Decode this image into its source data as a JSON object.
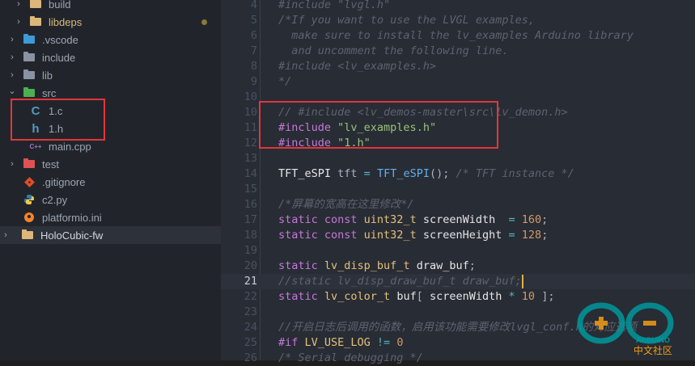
{
  "explorer": {
    "items": [
      {
        "label": "build",
        "chevron": "›",
        "icon": "folder-icon",
        "color": "#dcb67a",
        "text_color": "#9da5b4"
      },
      {
        "label": "libdeps",
        "chevron": "›",
        "icon": "folder-icon",
        "color": "#dcb67a",
        "text_color": "#d7ba7d",
        "modified_dot": "#8a7a3a"
      },
      {
        "label": ".vscode",
        "chevron": "›",
        "icon": "vscode-folder-icon",
        "color": "#3c9bd8",
        "text_color": "#9da5b4"
      },
      {
        "label": "include",
        "chevron": "›",
        "icon": "include-folder-icon",
        "color": "#8a93a3",
        "text_color": "#9da5b4"
      },
      {
        "label": "lib",
        "chevron": "›",
        "icon": "lib-folder-icon",
        "color": "#8a93a3",
        "text_color": "#9da5b4"
      },
      {
        "label": "src",
        "chevron": "⌄",
        "icon": "src-folder-icon",
        "color": "#4caf50",
        "text_color": "#9da5b4"
      },
      {
        "label": "1.c",
        "chevron": "",
        "icon": "c-file-icon",
        "icon_text": "C",
        "color": "#519aba",
        "text_color": "#9da5b4"
      },
      {
        "label": "1.h",
        "chevron": "",
        "icon": "h-file-icon",
        "icon_text": "h",
        "color": "#519aba",
        "text_color": "#9da5b4"
      },
      {
        "label": "main.cpp",
        "chevron": "",
        "icon": "cpp-file-icon",
        "icon_text": "C++",
        "color": "#a074c4",
        "text_color": "#9da5b4"
      },
      {
        "label": "test",
        "chevron": "›",
        "icon": "test-folder-icon",
        "color": "#e05252",
        "text_color": "#9da5b4"
      },
      {
        "label": ".gitignore",
        "chevron": "",
        "icon": "git-icon",
        "color": "#e44d26",
        "text_color": "#9da5b4"
      },
      {
        "label": "c2.py",
        "chevron": "",
        "icon": "python-icon",
        "color": "#3c78aa",
        "text_color": "#9da5b4"
      },
      {
        "label": "platformio.ini",
        "chevron": "",
        "icon": "platformio-icon",
        "color": "#f5822a",
        "text_color": "#9da5b4"
      },
      {
        "label": "HoloCubic-fw",
        "chevron": "›",
        "icon": "folder-icon",
        "color": "#dcb67a",
        "text_color": "#d4d7dd",
        "selected": true
      }
    ]
  },
  "editor": {
    "current_line": "21",
    "lines": [
      {
        "n": "4",
        "tokens": [
          [
            "cm",
            "#include \"lvgl.h\""
          ]
        ]
      },
      {
        "n": "5",
        "tokens": [
          [
            "cm",
            "/*If you want to use the LVGL examples,"
          ]
        ]
      },
      {
        "n": "6",
        "tokens": [
          [
            "cm",
            "  make sure to install the lv_examples Arduino library"
          ]
        ]
      },
      {
        "n": "7",
        "tokens": [
          [
            "cm",
            "  and uncomment the following line."
          ]
        ]
      },
      {
        "n": "8",
        "tokens": [
          [
            "cm",
            "#include <lv_examples.h>"
          ]
        ]
      },
      {
        "n": "9",
        "tokens": [
          [
            "cm",
            "*/"
          ]
        ]
      },
      {
        "n": "10",
        "tokens": []
      },
      {
        "n": "10",
        "tokens": [
          [
            "cm",
            "// #include <lv_demos-master\\src\\lv_demon.h>"
          ]
        ]
      },
      {
        "n": "11",
        "tokens": [
          [
            "kw",
            "#include "
          ],
          [
            "str",
            "\"lv_examples.h\""
          ]
        ]
      },
      {
        "n": "12",
        "tokens": [
          [
            "kw",
            "#include "
          ],
          [
            "str",
            "\"1.h\""
          ]
        ]
      },
      {
        "n": "13",
        "tokens": []
      },
      {
        "n": "14",
        "tokens": [
          [
            "var",
            "TFT_eSPI"
          ],
          [
            "pl",
            " tft "
          ],
          [
            "op",
            "="
          ],
          [
            "pl",
            " "
          ],
          [
            "fn",
            "TFT_eSPI"
          ],
          [
            "pl",
            "(); "
          ],
          [
            "cm",
            "/* TFT instance */"
          ]
        ]
      },
      {
        "n": "15",
        "tokens": []
      },
      {
        "n": "16",
        "tokens": [
          [
            "cm",
            "/*屏幕的宽高在这里修改*/"
          ]
        ]
      },
      {
        "n": "17",
        "tokens": [
          [
            "kw",
            "static const "
          ],
          [
            "ty",
            "uint32_t "
          ],
          [
            "var",
            "screenWidth"
          ],
          [
            "pl",
            "  "
          ],
          [
            "op",
            "="
          ],
          [
            "pl",
            " "
          ],
          [
            "num",
            "160"
          ],
          [
            "pl",
            ";"
          ]
        ]
      },
      {
        "n": "18",
        "tokens": [
          [
            "kw",
            "static const "
          ],
          [
            "ty",
            "uint32_t "
          ],
          [
            "var",
            "screenHeight"
          ],
          [
            "pl",
            " "
          ],
          [
            "op",
            "="
          ],
          [
            "pl",
            " "
          ],
          [
            "num",
            "128"
          ],
          [
            "pl",
            ";"
          ]
        ]
      },
      {
        "n": "19",
        "tokens": []
      },
      {
        "n": "20",
        "tokens": [
          [
            "kw",
            "static "
          ],
          [
            "ty",
            "lv_disp_buf_t "
          ],
          [
            "var",
            "draw_buf"
          ],
          [
            "pl",
            ";"
          ]
        ]
      },
      {
        "n": "21",
        "tokens": [
          [
            "cm",
            "//static lv_disp_draw_buf_t draw_buf;"
          ]
        ]
      },
      {
        "n": "22",
        "tokens": [
          [
            "kw",
            "static "
          ],
          [
            "ty",
            "lv_color_t "
          ],
          [
            "var",
            "buf"
          ],
          [
            "pl",
            "[ "
          ],
          [
            "var",
            "screenWidth"
          ],
          [
            "pl",
            " "
          ],
          [
            "op",
            "*"
          ],
          [
            "pl",
            " "
          ],
          [
            "num",
            "10"
          ],
          [
            "pl",
            " ];"
          ]
        ]
      },
      {
        "n": "23",
        "tokens": []
      },
      {
        "n": "24",
        "tokens": [
          [
            "cm",
            "//开启日志后调用的函数，启用该功能需要修改lvgl_conf.h的对应选项"
          ]
        ]
      },
      {
        "n": "25",
        "tokens": [
          [
            "kw",
            "#if "
          ],
          [
            "ty",
            "LV_USE_LOG "
          ],
          [
            "op",
            "!="
          ],
          [
            "pl",
            " "
          ],
          [
            "num",
            "0"
          ]
        ]
      },
      {
        "n": "26",
        "tokens": [
          [
            "cm",
            "/* Serial debugging */"
          ]
        ]
      }
    ]
  },
  "watermark": {
    "brand": "ARDUINO",
    "sub": "中文社区",
    "ring_color": "#00979c",
    "plus_color": "#f39c12"
  }
}
